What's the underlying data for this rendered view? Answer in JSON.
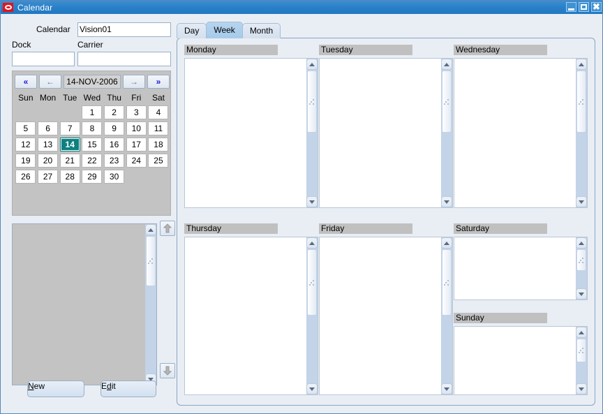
{
  "window": {
    "title": "Calendar",
    "logo_icon": "oracle-logo-icon",
    "minimize_label": "",
    "maximize_label": "",
    "close_label": "✖"
  },
  "form": {
    "calendar_label": "Calendar",
    "calendar_value": "Vision01",
    "calendar_placeholder": "",
    "dock_label": "Dock",
    "dock_value": "",
    "dock_placeholder": "",
    "carrier_label": "Carrier",
    "carrier_value": "",
    "carrier_placeholder": ""
  },
  "minicalendar": {
    "first_button": "«",
    "prev_button": "←",
    "date_value": "14-NOV-2006",
    "next_button": "→",
    "last_button": "»",
    "dow_headers": [
      "Sun",
      "Mon",
      "Tue",
      "Wed",
      "Thu",
      "Fri",
      "Sat"
    ],
    "selected_day": 14,
    "weeks": [
      [
        "",
        "",
        "",
        "1",
        "2",
        "3",
        "4"
      ],
      [
        "5",
        "6",
        "7",
        "8",
        "9",
        "10",
        "11"
      ],
      [
        "12",
        "13",
        "14",
        "15",
        "16",
        "17",
        "18"
      ],
      [
        "19",
        "20",
        "21",
        "22",
        "23",
        "24",
        "25"
      ],
      [
        "26",
        "27",
        "28",
        "29",
        "30",
        "",
        ""
      ]
    ],
    "selected_bg": "#0e8080",
    "panel_bg": "#c3c3c3"
  },
  "list_panel": {
    "items": [],
    "move_up_icon": "arrow-up-icon",
    "move_down_icon": "arrow-down-icon"
  },
  "buttons": {
    "new_label": "New",
    "new_mnemonic": "N",
    "new_rest": "ew",
    "edit_pre": "E",
    "edit_mnemonic": "d",
    "edit_rest": "it",
    "edit_label": "Edit"
  },
  "tabs": [
    {
      "label": "Day",
      "active": false
    },
    {
      "label": "Week",
      "active": true
    },
    {
      "label": "Month",
      "active": false
    }
  ],
  "week_view": {
    "days": [
      {
        "name": "Monday",
        "entries": [],
        "scroll_thumb_pct": 42
      },
      {
        "name": "Tuesday",
        "entries": [],
        "scroll_thumb_pct": 42
      },
      {
        "name": "Wednesday",
        "entries": [],
        "scroll_thumb_pct": 42
      },
      {
        "name": "Thursday",
        "entries": [],
        "scroll_thumb_pct": 42
      },
      {
        "name": "Friday",
        "entries": [],
        "scroll_thumb_pct": 42
      },
      {
        "name": "Saturday",
        "entries": [],
        "scroll_thumb_pct": 35
      },
      {
        "name": "Sunday",
        "entries": [],
        "scroll_thumb_pct": 35
      }
    ],
    "header_bg": "#c0c0c0",
    "scroll_track": "#c3d3e8"
  }
}
